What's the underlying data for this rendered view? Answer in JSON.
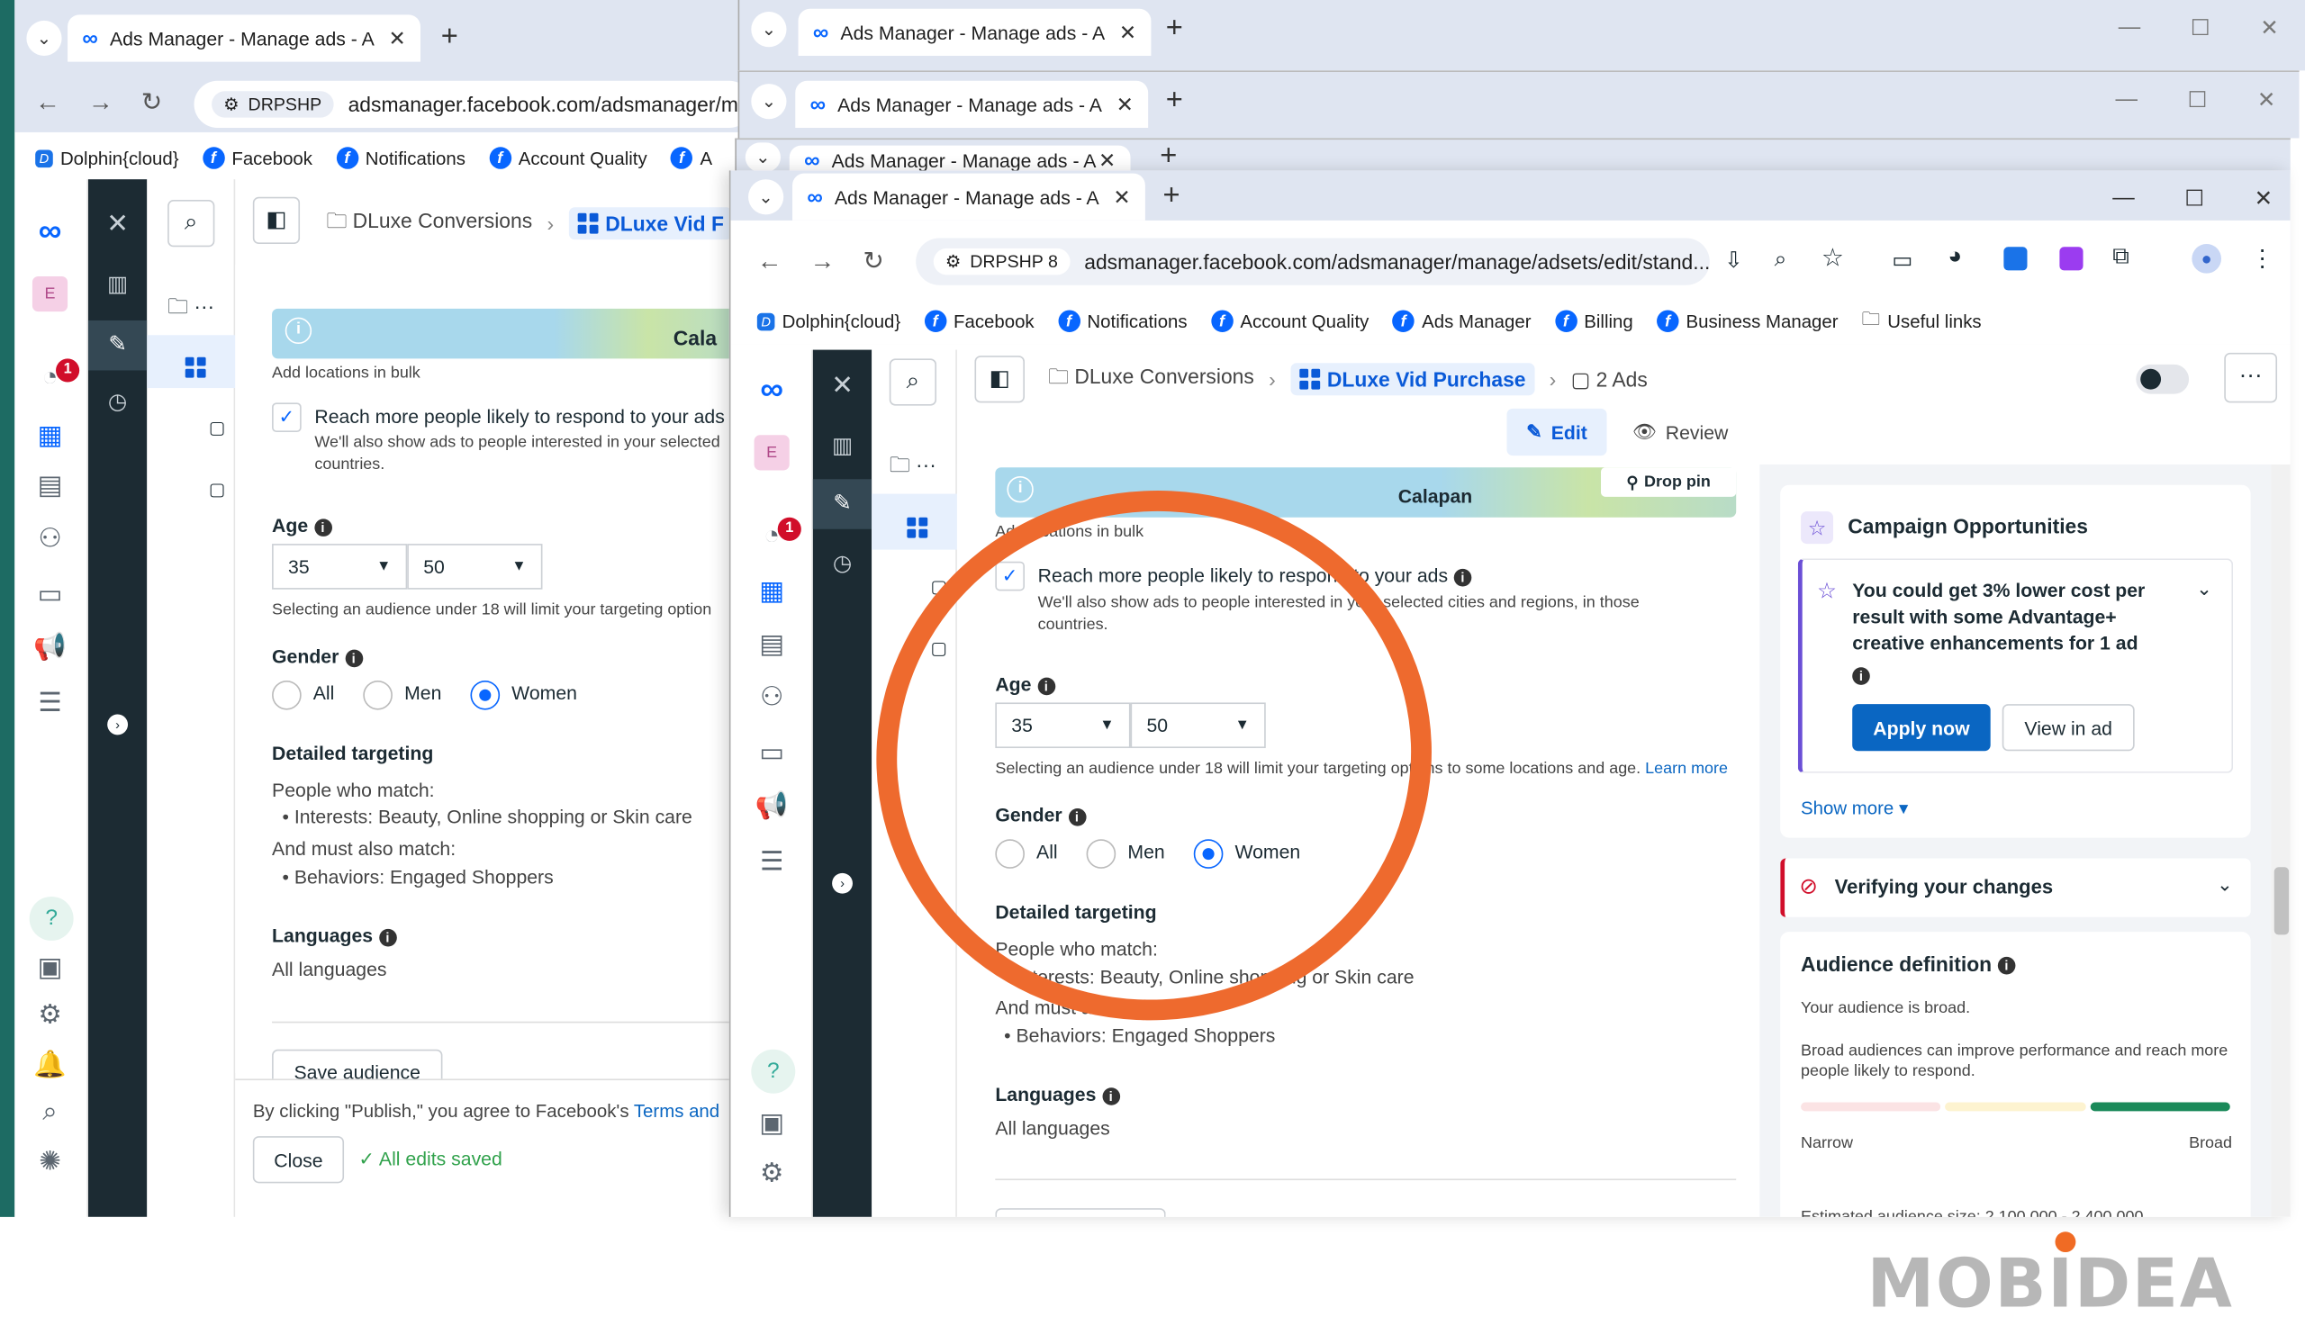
{
  "tab_title": "Ads Manager - Manage ads - A",
  "back_window": {
    "profile": "DRPSHP",
    "url": "adsmanager.facebook.com/adsmanager/ma",
    "bookmarks": [
      "Dolphin{cloud}",
      "Facebook",
      "Notifications",
      "Account Quality",
      "A"
    ],
    "breadcrumb": {
      "campaign": "DLuxe Conversions",
      "adset": "DLuxe Vid F"
    },
    "map_label": "Cala",
    "bulk_link": "Add locations in bulk",
    "reach": {
      "title": "Reach more people likely to respond to your ads",
      "desc": "We'll also show ads to people interested in your selected",
      "desc2": "countries."
    },
    "age": {
      "label": "Age",
      "min": "35",
      "max": "50",
      "note": "Selecting an audience under 18 will limit your targeting option"
    },
    "gender": {
      "label": "Gender",
      "options": [
        "All",
        "Men",
        "Women"
      ],
      "selected": "Women"
    },
    "detailed": {
      "label": "Detailed targeting",
      "match": "People who match:",
      "interests": "Interests: Beauty, Online shopping or Skin care",
      "also": "And must also match:",
      "behaviors": "Behaviors: Engaged Shoppers"
    },
    "languages": {
      "label": "Languages",
      "value": "All languages"
    },
    "save_audience": "Save audience",
    "publish_note": "By clicking \"Publish,\" you agree to Facebook's",
    "terms": "Terms and",
    "close": "Close",
    "saved": "All edits saved",
    "badge": "1"
  },
  "front_window": {
    "profile": "DRPSHP 8",
    "url": "adsmanager.facebook.com/adsmanager/manage/adsets/edit/stand...",
    "bookmarks": [
      "Dolphin{cloud}",
      "Facebook",
      "Notifications",
      "Account Quality",
      "Ads Manager",
      "Billing",
      "Business Manager",
      "Useful links"
    ],
    "breadcrumb": {
      "campaign": "DLuxe Conversions",
      "adset": "DLuxe Vid Purchase",
      "ads": "2 Ads"
    },
    "modes": {
      "edit": "Edit",
      "review": "Review"
    },
    "map_label": "Calapan",
    "drop_pin": "Drop pin",
    "bulk_link": "Add locations in bulk",
    "reach": {
      "title": "Reach more people likely to respond to your ads",
      "desc": "We'll also show ads to people interested in your selected cities and regions, in those",
      "desc2": "countries."
    },
    "age": {
      "label": "Age",
      "min": "35",
      "max": "50",
      "note": "Selecting an audience under 18 will limit your targeting options to some locations and age.",
      "learn": "Learn more"
    },
    "gender": {
      "label": "Gender",
      "options": [
        "All",
        "Men",
        "Women"
      ],
      "selected": "Women"
    },
    "detailed": {
      "label": "Detailed targeting",
      "match": "People who match:",
      "interests": "Interests: Beauty, Online shopping or Skin care",
      "also": "And must also match:",
      "behaviors": "Behaviors: Engaged Shoppers"
    },
    "languages": {
      "label": "Languages",
      "value": "All languages"
    },
    "badge": "1",
    "opportunities": {
      "title": "Campaign Opportunities",
      "item": "You could get 3% lower cost per result with some Advantage+ creative enhancements for 1 ad",
      "apply": "Apply now",
      "view": "View in ad",
      "show_more": "Show more"
    },
    "verifying": "Verifying your changes",
    "audience": {
      "title": "Audience definition",
      "status": "Your audience is broad.",
      "desc": "Broad audiences can improve performance and reach more people likely to respond.",
      "narrow": "Narrow",
      "broad": "Broad",
      "size": "Estimated audience size: 2,100,000 - 2,400,000"
    }
  },
  "other_tabs": [
    "Ads Manager - Manage ads - A",
    "Ads Manager - Manage ads - A",
    "Ads Manager - Manage ads - A"
  ],
  "watermark": "MOBIDEA",
  "colors": {
    "accent": "#0866ff",
    "annotation": "#ee6a2e",
    "dark_rail": "#1c2b33"
  }
}
